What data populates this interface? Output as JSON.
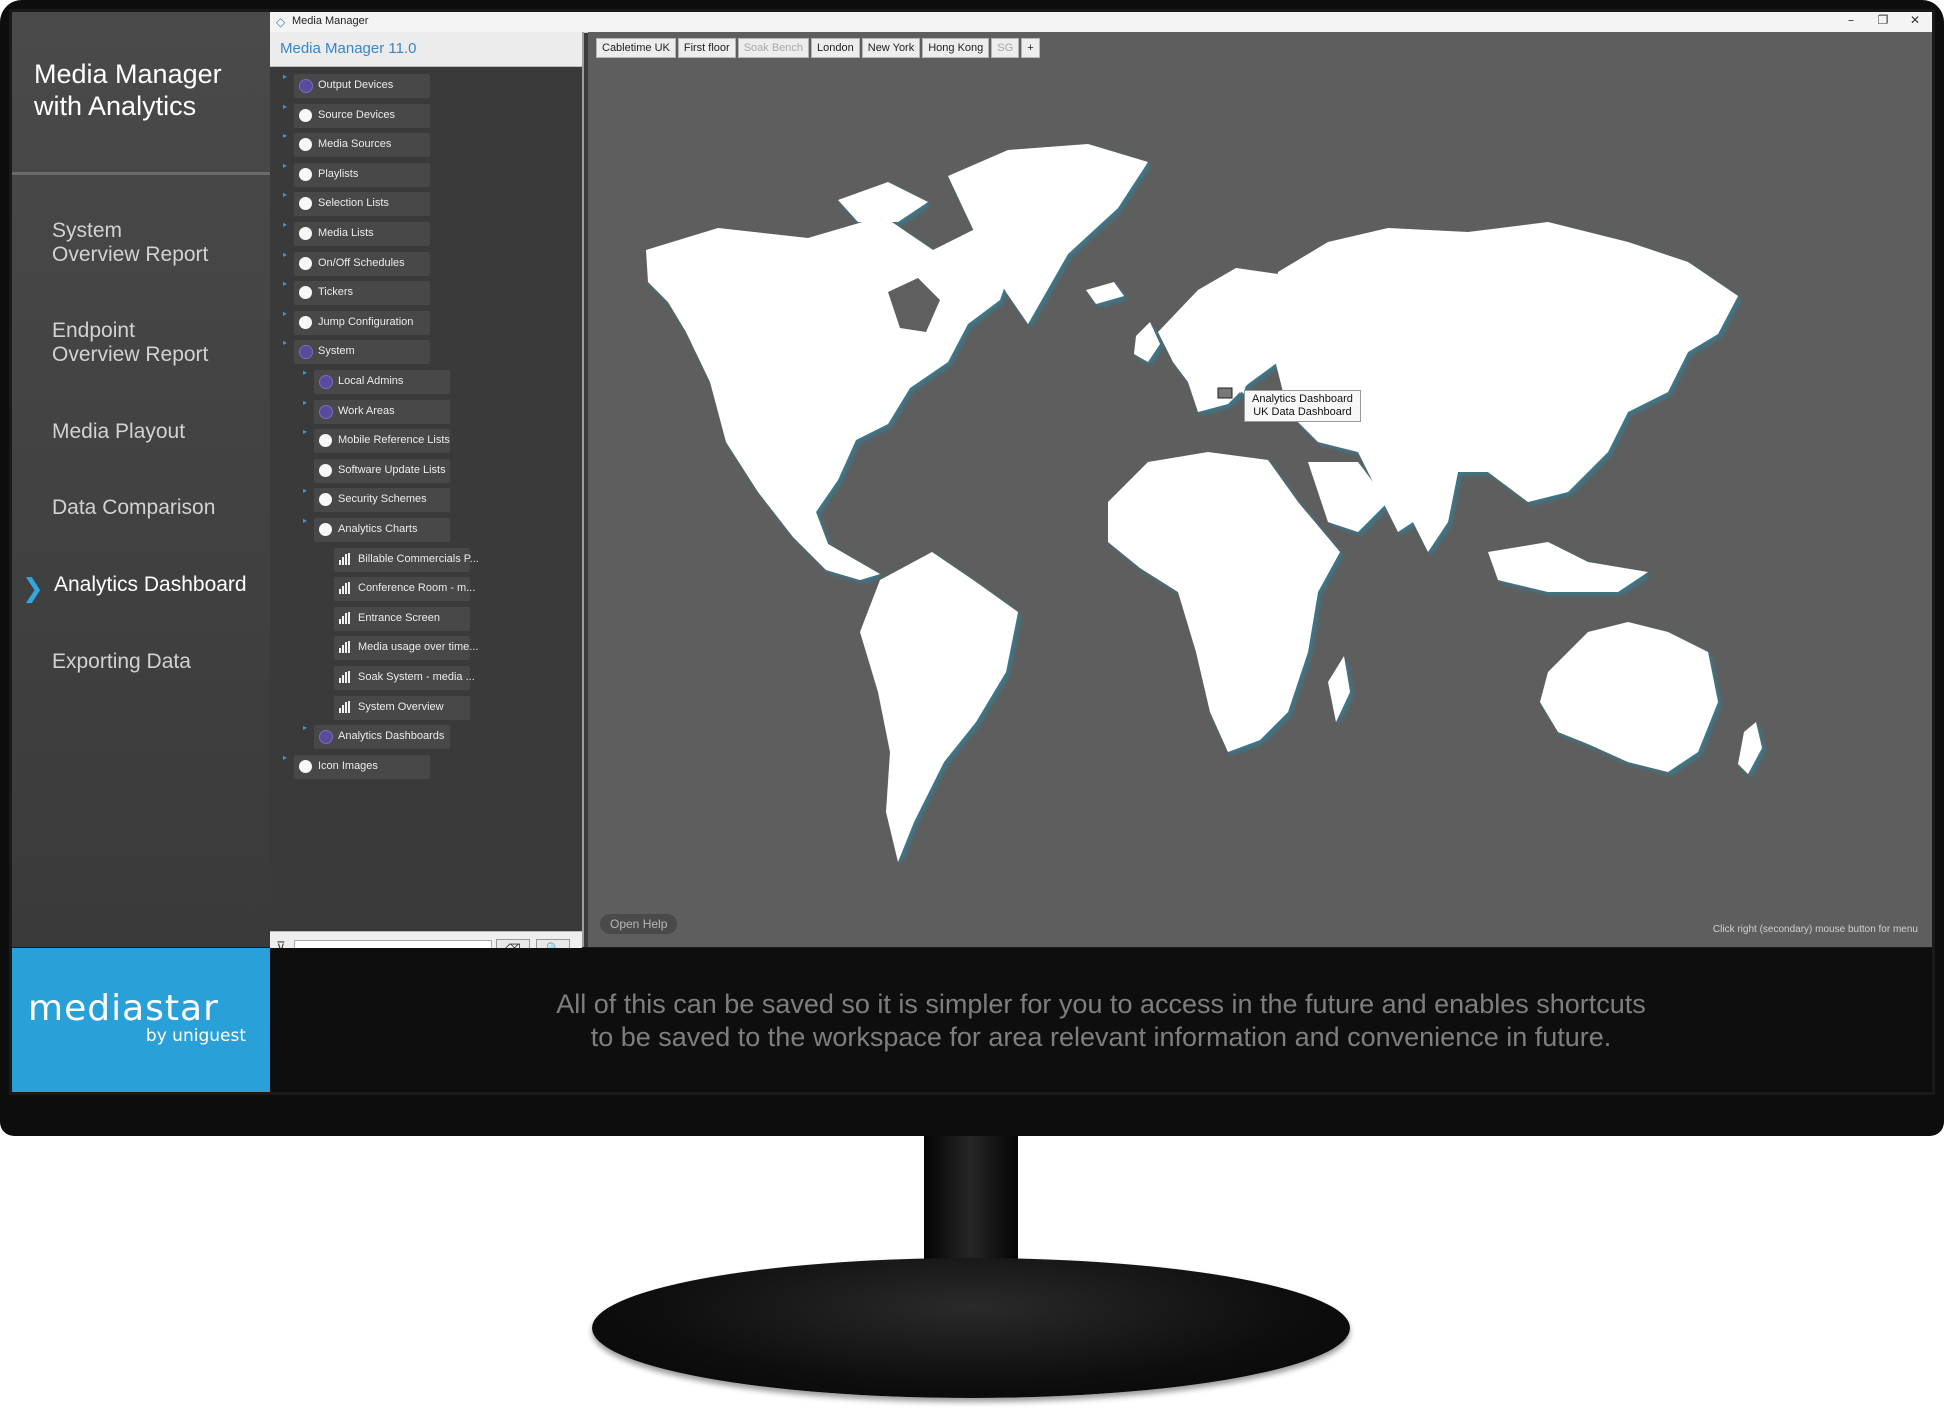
{
  "presentation": {
    "title": "Media Manager\nwith Analytics",
    "nav": [
      {
        "label": "System\nOverview Report"
      },
      {
        "label": "Endpoint\nOverview Report"
      },
      {
        "label": "Media Playout"
      },
      {
        "label": "Data Comparison"
      },
      {
        "label": "Analytics Dashboard",
        "active": true
      },
      {
        "label": "Exporting Data"
      }
    ],
    "active_marker": "❯"
  },
  "window": {
    "title": "Media Manager",
    "controls": [
      "–",
      "❐",
      "✕"
    ]
  },
  "tree": {
    "app_name": "Media Manager 11.0",
    "nodes": [
      {
        "label": "Output Devices"
      },
      {
        "label": "Source Devices"
      },
      {
        "label": "Media Sources"
      },
      {
        "label": "Playlists"
      },
      {
        "label": "Selection Lists"
      },
      {
        "label": "Media Lists"
      },
      {
        "label": "On/Off Schedules"
      },
      {
        "label": "Tickers"
      },
      {
        "label": "Jump Configuration"
      },
      {
        "label": "System"
      },
      {
        "label": "Local Admins"
      },
      {
        "label": "Work Areas"
      },
      {
        "label": "Mobile Reference Lists"
      },
      {
        "label": "Software Update Lists"
      },
      {
        "label": "Security Schemes"
      },
      {
        "label": "Analytics Charts"
      },
      {
        "label": "Billable Commercials P..."
      },
      {
        "label": "Conference Room - m..."
      },
      {
        "label": "Entrance Screen"
      },
      {
        "label": "Media usage over time..."
      },
      {
        "label": "Soak System - media ..."
      },
      {
        "label": "System Overview"
      },
      {
        "label": "Analytics Dashboards"
      },
      {
        "label": "Icon Images"
      }
    ],
    "filter_icon": "filter-icon",
    "clear_icon": "⌫",
    "search_icon": "🔍"
  },
  "tabs": [
    {
      "label": "Cabletime UK"
    },
    {
      "label": "First floor"
    },
    {
      "label": "Soak Bench"
    },
    {
      "label": "London"
    },
    {
      "label": "New York"
    },
    {
      "label": "Hong Kong"
    },
    {
      "label": "SG"
    },
    {
      "label": "+"
    }
  ],
  "map": {
    "tooltip_line1": "Analytics Dashboard",
    "tooltip_line2": "UK Data Dashboard",
    "open_help": "Open Help",
    "hint": "Click right (secondary) mouse button for menu"
  },
  "brand": {
    "name": "mediastar",
    "tagline": "by uniguest",
    "color": "#29a1d8"
  },
  "caption": "All of this can be saved so it is simpler for you to access in the future and enables shortcuts\nto be saved to the workspace for area relevant information and convenience in future."
}
